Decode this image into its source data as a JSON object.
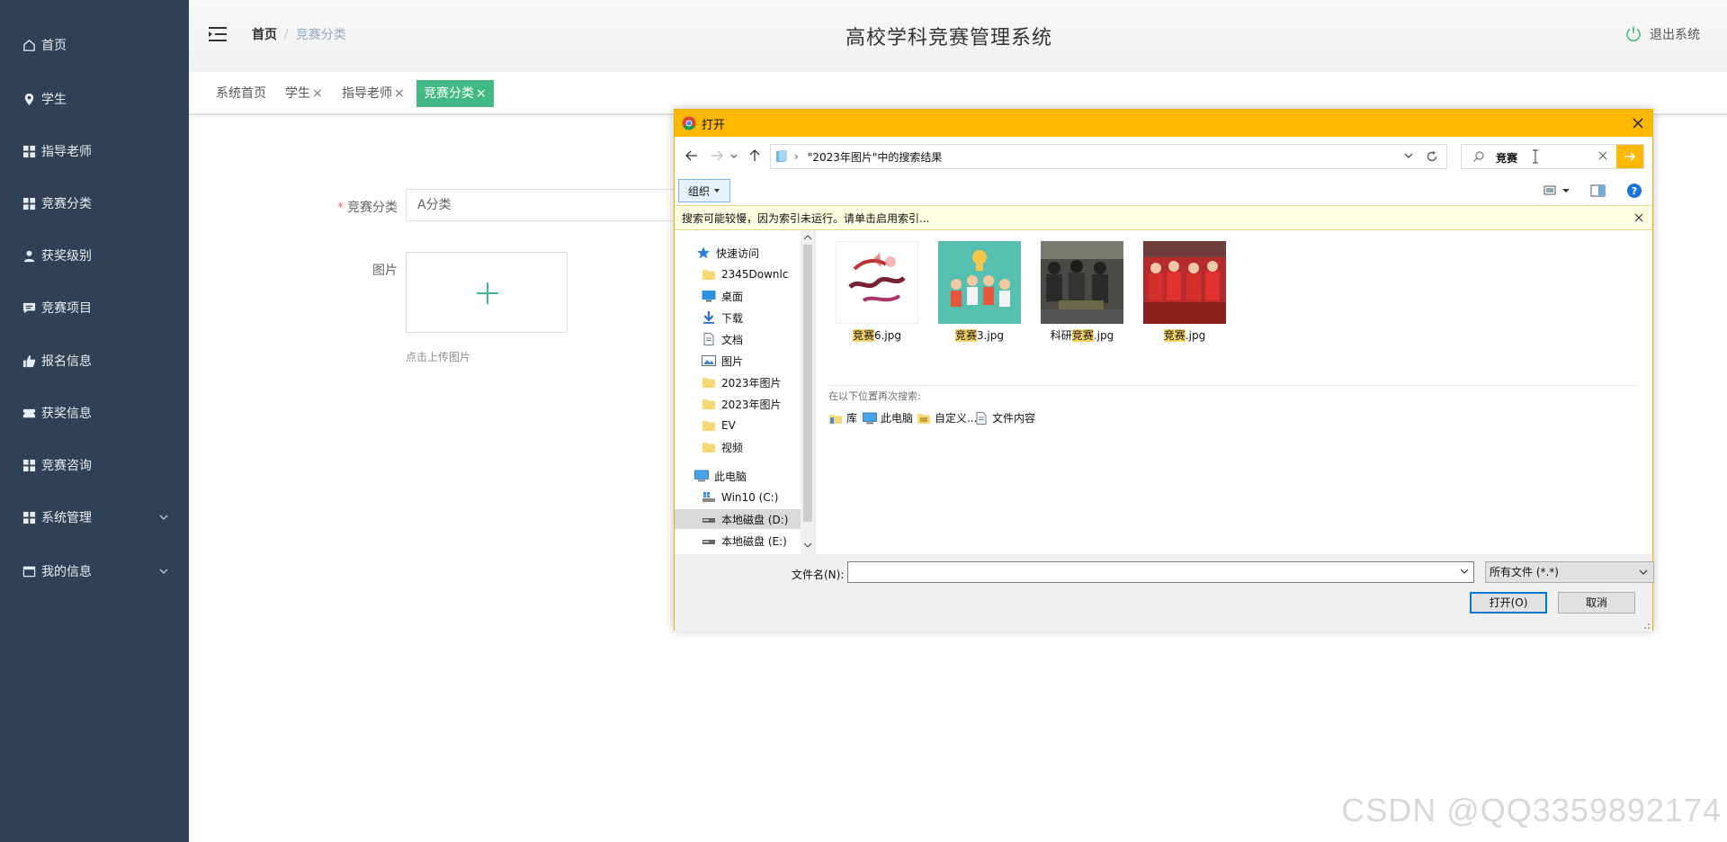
{
  "sidebar": {
    "items": [
      {
        "label": "首页",
        "icon": "home-icon"
      },
      {
        "label": "学生",
        "icon": "location-pin-icon"
      },
      {
        "label": "指导老师",
        "icon": "grid-icon"
      },
      {
        "label": "竞赛分类",
        "icon": "grid-icon"
      },
      {
        "label": "获奖级别",
        "icon": "user-icon"
      },
      {
        "label": "竞赛项目",
        "icon": "chat-icon"
      },
      {
        "label": "报名信息",
        "icon": "thumb-icon"
      },
      {
        "label": "获奖信息",
        "icon": "ticket-icon"
      },
      {
        "label": "竞赛咨询",
        "icon": "grid-icon"
      },
      {
        "label": "系统管理",
        "icon": "grid-icon"
      },
      {
        "label": "我的信息",
        "icon": "card-icon"
      }
    ]
  },
  "header": {
    "breadcrumb": [
      "首页",
      "竞赛分类"
    ],
    "title": "高校学科竞赛管理系统",
    "logout": "退出系统"
  },
  "tabs": [
    {
      "label": "系统首页",
      "closable": false,
      "active": false
    },
    {
      "label": "学生",
      "closable": true,
      "active": false
    },
    {
      "label": "指导老师",
      "closable": true,
      "active": false
    },
    {
      "label": "竞赛分类",
      "closable": true,
      "active": true
    }
  ],
  "tab_close_glyph": "×",
  "form": {
    "category_label": "竞赛分类",
    "category_value": "A分类",
    "image_label": "图片",
    "upload_hint": "点击上传图片"
  },
  "dialog": {
    "title": "打开",
    "address": "\"2023年图片\"中的搜索结果",
    "search_text": "竞赛",
    "organize": "组织",
    "info_bar": "搜索可能较慢，因为索引未运行。请单击启用索引...",
    "tree": [
      {
        "label": "快速访问",
        "level": 0,
        "pinned": false
      },
      {
        "label": "2345Downlc",
        "level": 1,
        "pinned": true
      },
      {
        "label": "桌面",
        "level": 1,
        "pinned": true
      },
      {
        "label": "下载",
        "level": 1,
        "pinned": true
      },
      {
        "label": "文档",
        "level": 1,
        "pinned": true
      },
      {
        "label": "图片",
        "level": 1,
        "pinned": true
      },
      {
        "label": "2023年图片",
        "level": 1,
        "pinned": false
      },
      {
        "label": "2023年图片",
        "level": 1,
        "pinned": false
      },
      {
        "label": "EV",
        "level": 1,
        "pinned": false
      },
      {
        "label": "视频",
        "level": 1,
        "pinned": false
      },
      {
        "label": "此电脑",
        "level": 0,
        "pinned": false
      },
      {
        "label": "Win10 (C:)",
        "level": 1,
        "pinned": false
      },
      {
        "label": "本地磁盘 (D:)",
        "level": 1,
        "pinned": false
      },
      {
        "label": "本地磁盘 (E:)",
        "level": 1,
        "pinned": false
      }
    ],
    "files": [
      {
        "pre": "",
        "hl": "竞赛",
        "post": "6.jpg"
      },
      {
        "pre": "",
        "hl": "竞赛",
        "post": "3.jpg"
      },
      {
        "pre": "科研",
        "hl": "竞赛",
        "post": ".jpg"
      },
      {
        "pre": "",
        "hl": "竞赛",
        "post": ".jpg"
      }
    ],
    "search_again_label": "在以下位置再次搜索:",
    "search_locations": [
      "库",
      "此电脑",
      "自定义...",
      "文件内容"
    ],
    "filename_label": "文件名(N):",
    "filename_value": "",
    "filetype": "所有文件 (*.*)",
    "open_button": "打开(O)",
    "cancel_button": "取消"
  },
  "watermark": "CSDN @QQ3359892174",
  "colors": {
    "sidebar_bg": "#304156",
    "accent": "#42b983",
    "dialog_title_bg": "#fdb900"
  }
}
